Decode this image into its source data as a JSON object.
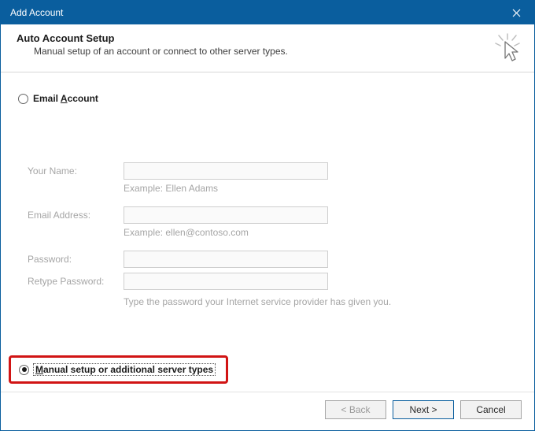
{
  "titlebar": {
    "title": "Add Account"
  },
  "header": {
    "title": "Auto Account Setup",
    "subtitle": "Manual setup of an account or connect to other server types."
  },
  "options": {
    "email_account_label_pre": "Email ",
    "email_account_label_accel": "A",
    "email_account_label_post": "ccount",
    "manual_label_pre": "",
    "manual_label_accel": "M",
    "manual_label_post": "anual setup or additional server types",
    "selected": "manual"
  },
  "form": {
    "your_name_label": "Your Name:",
    "your_name_hint": "Example: Ellen Adams",
    "email_label": "Email Address:",
    "email_hint": "Example: ellen@contoso.com",
    "password_label": "Password:",
    "retype_label": "Retype Password:",
    "password_hint": "Type the password your Internet service provider has given you."
  },
  "buttons": {
    "back": "< Back",
    "next": "Next >",
    "cancel": "Cancel"
  },
  "icons": {
    "close": "close",
    "cursor": "cursor-click"
  }
}
